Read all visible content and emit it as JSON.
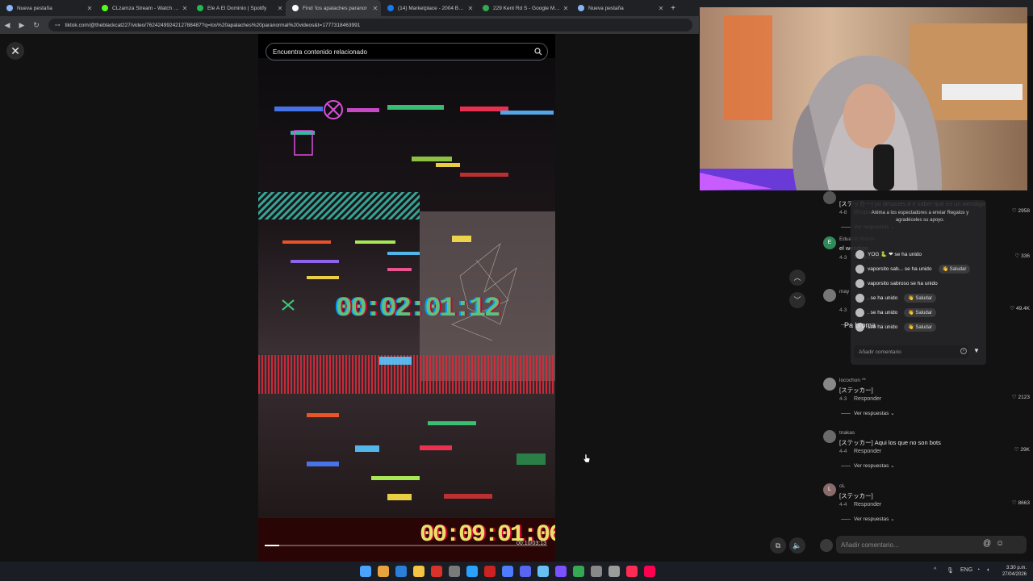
{
  "browser": {
    "tabs": [
      {
        "label": "Nueva pestaña",
        "favicon_color": "#8ab4f8",
        "active": false
      },
      {
        "label": "CLzamza Stream - Watch Live o",
        "favicon_color": "#53fc18",
        "active": false
      },
      {
        "label": "Ele A El Dominio | Spotify",
        "favicon_color": "#1db954",
        "active": false
      },
      {
        "label": "Find 'los apalaches paranor",
        "favicon_color": "#ffffff",
        "active": true
      },
      {
        "label": "(14) Marketplace - 2004 BMW 3",
        "favicon_color": "#1877f2",
        "active": false
      },
      {
        "label": "229 Kent Rd S - Google Maps",
        "favicon_color": "#34a853",
        "active": false
      },
      {
        "label": "Nueva pestaña",
        "favicon_color": "#8ab4f8",
        "active": false
      }
    ],
    "new_tab": "+",
    "url": "tiktok.com/@theblackcat227/video/7624249924212788487?q=los%20apalaches%20paranormal%20videos&t=1777318463991"
  },
  "video": {
    "search_placeholder": "Encuentra contenido relacionado",
    "timecode_main": "00:02:01:12",
    "timecode_bottom": "00:09:01:06",
    "time_display": "00:10/03:13",
    "progress": 0.05
  },
  "comments": [
    {
      "avatar": "",
      "avatar_color": "#555",
      "user": "",
      "text": "[ステッカー] yo despues d e saber que es un wendigo",
      "date": "4-8",
      "reply": "Responder",
      "likes": "2958",
      "view_replies": "Ver respuestas"
    },
    {
      "avatar": "E",
      "avatar_color": "#2e8b57",
      "user": "Eduardo Rıbón",
      "text": "el wendigo",
      "date": "4-3",
      "reply": "Responder",
      "likes": "336",
      "view_replies": ""
    },
    {
      "avatar": "",
      "avatar_color": "#777",
      "user": "may",
      "text": "",
      "date": "4-3",
      "reply": "",
      "likes": "49.4K",
      "view_replies": "Ver respuestas"
    },
    {
      "avatar": "",
      "avatar_color": "#888",
      "user": "locochon **",
      "text": "[ステッカー]",
      "date": "4-3",
      "reply": "Responder",
      "likes": "2123",
      "view_replies": "Ver respuestas"
    },
    {
      "avatar": "",
      "avatar_color": "#6a6a6a",
      "user": "tnakas",
      "text": "[ステッカー] Aqui los que no son bots",
      "date": "4-4",
      "reply": "Responder",
      "likes": "29K",
      "view_replies": "Ver respuestas"
    },
    {
      "avatar": "L",
      "avatar_color": "#8a6a6a",
      "user": "oL",
      "text": "[ステッカー]",
      "date": "4-4",
      "reply": "Responder",
      "likes": "8663",
      "view_replies": "Ver respuestas"
    }
  ],
  "add_comment_placeholder": "Añadir comentario...",
  "stream_panel": {
    "hint": "Anima a los espectadores a enviar Regalos y agradéceles su apoyo.",
    "joins": [
      {
        "name": "YOG 🐍 ❤ se ha unido",
        "saludar": ""
      },
      {
        "name": "vaporsito sab... se ha unido",
        "saludar": "Saludar"
      },
      {
        "name": "vaporsito sabroso se ha unido",
        "saludar": ""
      },
      {
        "name": ". se ha unido",
        "saludar": "Saludar"
      },
      {
        "name": ". se ha unido",
        "saludar": "Saludar"
      },
      {
        "name": "see ha unido",
        "saludar": "Saludar"
      }
    ],
    "input_placeholder": "Añadir comentario",
    "overlap_text": "Pa broma"
  },
  "taskbar": {
    "time": "3:30 p.m.",
    "date": "27/04/2026",
    "lang": "ENG",
    "icon_colors": [
      "#4aa3ff",
      "#e8a33d",
      "#2b7fd9",
      "#f4c443",
      "#d9322b",
      "#7a7a7a",
      "#2aa1ff",
      "#c22",
      "#4d7cff",
      "#5865f2",
      "#66c0f4",
      "#7b52ff",
      "#34a853",
      "#888",
      "#9b9b9b",
      "#fe2c55",
      "#ff0050"
    ]
  },
  "colors": {
    "accent": "#fe2c55",
    "background": "#121212"
  }
}
